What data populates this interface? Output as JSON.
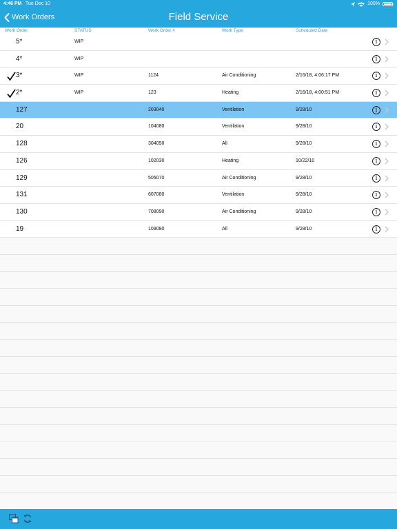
{
  "status_bar": {
    "time": "4:46 PM",
    "date": "Tue Dec 10",
    "battery": "100%"
  },
  "nav": {
    "back_label": "Work Orders",
    "title": "Field Service"
  },
  "columns": [
    "Work Order",
    "STATUS",
    "Work Order #",
    "Work Type",
    "Scheduled Date"
  ],
  "rows": [
    {
      "wo": "5*",
      "status": "WIP",
      "num": "",
      "type": "",
      "date": "",
      "checked": false,
      "selected": false
    },
    {
      "wo": "4*",
      "status": "WIP",
      "num": "",
      "type": "",
      "date": "",
      "checked": false,
      "selected": false
    },
    {
      "wo": "3*",
      "status": "WIP",
      "num": "1124",
      "type": "Air Conditioning",
      "date": "2/16/18, 4:06:17 PM",
      "checked": true,
      "selected": false
    },
    {
      "wo": "2*",
      "status": "WIP",
      "num": "123",
      "type": "Heating",
      "date": "2/16/18, 4:00:51 PM",
      "checked": true,
      "selected": false
    },
    {
      "wo": "127",
      "status": "",
      "num": "203040",
      "type": "Ventilation",
      "date": "9/28/10",
      "checked": false,
      "selected": true
    },
    {
      "wo": "20",
      "status": "",
      "num": "104080",
      "type": "Ventilation",
      "date": "9/28/10",
      "checked": false,
      "selected": false
    },
    {
      "wo": "128",
      "status": "",
      "num": "304050",
      "type": "All",
      "date": "9/28/10",
      "checked": false,
      "selected": false
    },
    {
      "wo": "126",
      "status": "",
      "num": "102030",
      "type": "Heating",
      "date": "10/22/10",
      "checked": false,
      "selected": false
    },
    {
      "wo": "129",
      "status": "",
      "num": "506070",
      "type": "Air Conditioning",
      "date": "9/28/10",
      "checked": false,
      "selected": false
    },
    {
      "wo": "131",
      "status": "",
      "num": "607080",
      "type": "Ventilation",
      "date": "9/28/10",
      "checked": false,
      "selected": false
    },
    {
      "wo": "130",
      "status": "",
      "num": "708090",
      "type": "Air Conditioning",
      "date": "9/28/10",
      "checked": false,
      "selected": false
    },
    {
      "wo": "19",
      "status": "",
      "num": "109080",
      "type": "All",
      "date": "9/28/10",
      "checked": false,
      "selected": false
    }
  ],
  "info_glyph": "i",
  "icons": {
    "back": "chevron-left-icon",
    "info": "info-circle-icon",
    "disclosure": "chevron-right-icon",
    "check": "checkmark-icon",
    "toolbar_left": "windows-icon",
    "toolbar_right": "sync-icon"
  },
  "colors": {
    "accent": "#26a8de",
    "selected_row": "#7cc4f4"
  }
}
